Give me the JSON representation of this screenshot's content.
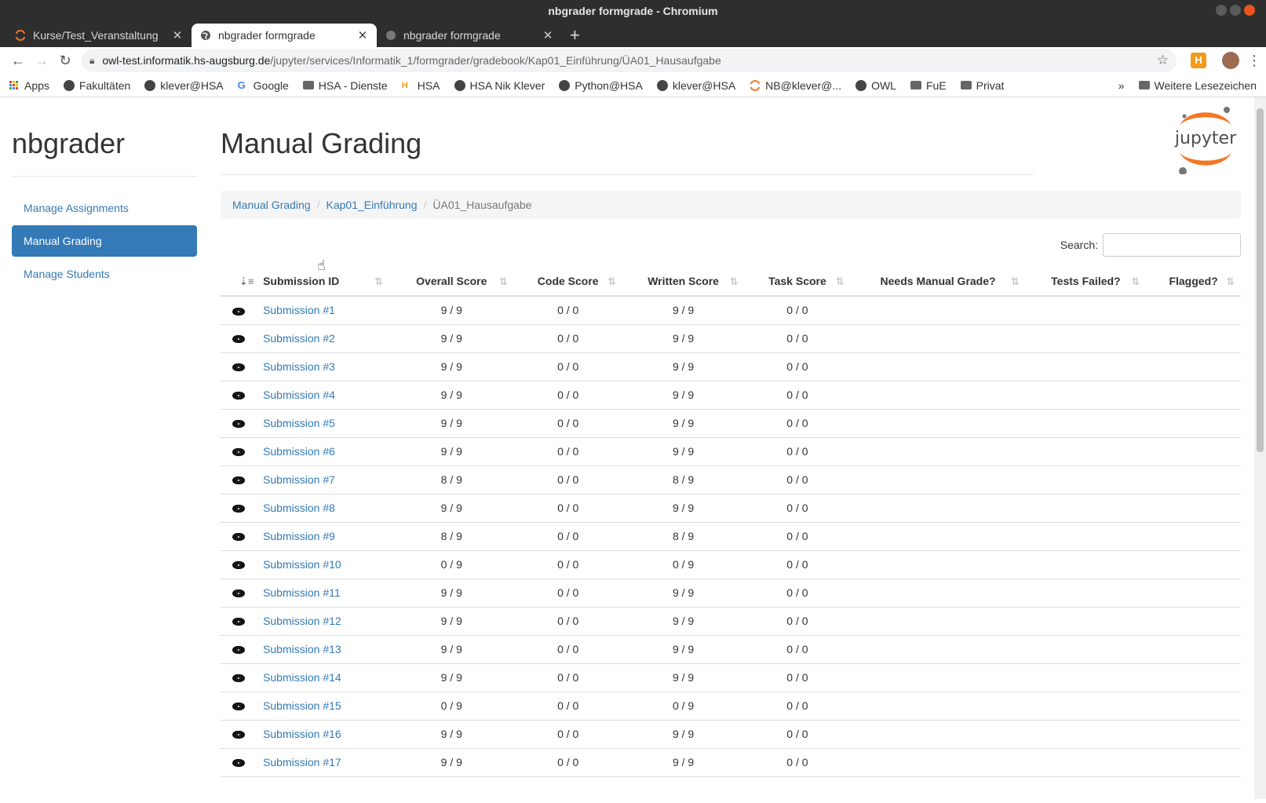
{
  "window": {
    "title": "nbgrader formgrade - Chromium"
  },
  "tabs": [
    {
      "label": "Kurse/Test_Veranstaltung",
      "active": false,
      "icon": "jupyter-icon"
    },
    {
      "label": "nbgrader formgrade",
      "active": true,
      "icon": "globe-icon"
    },
    {
      "label": "nbgrader formgrade",
      "active": false,
      "icon": "globe-icon"
    }
  ],
  "omnibox": {
    "host": "owl-test.informatik.hs-augsburg.de",
    "path": "/jupyter/services/Informatik_1/formgrader/gradebook/Kap01_Einführung/ÜA01_Hausaufgabe"
  },
  "bookmarks": {
    "items": [
      "Apps",
      "Fakultäten",
      "klever@HSA",
      "Google",
      "HSA - Dienste",
      "HSA",
      "HSA Nik Klever",
      "Python@HSA",
      "klever@HSA",
      "NB@klever@...",
      "OWL",
      "FuE",
      "Privat"
    ],
    "more": "»",
    "other": "Weitere Lesezeichen"
  },
  "sidebar": {
    "brand": "nbgrader",
    "items": [
      {
        "label": "Manage Assignments",
        "active": false
      },
      {
        "label": "Manual Grading",
        "active": true
      },
      {
        "label": "Manage Students",
        "active": false
      }
    ]
  },
  "main": {
    "title": "Manual Grading",
    "logo_text": "jupyter",
    "breadcrumb": [
      "Manual Grading",
      "Kap01_Einführung",
      "ÜA01_Hausaufgabe"
    ],
    "search_label": "Search:",
    "search_value": ""
  },
  "table": {
    "columns": [
      "Submission ID",
      "Overall Score",
      "Code Score",
      "Written Score",
      "Task Score",
      "Needs Manual Grade?",
      "Tests Failed?",
      "Flagged?"
    ],
    "rows": [
      {
        "id": "Submission #1",
        "overall": "9 / 9",
        "code": "0 / 0",
        "written": "9 / 9",
        "task": "0 / 0"
      },
      {
        "id": "Submission #2",
        "overall": "9 / 9",
        "code": "0 / 0",
        "written": "9 / 9",
        "task": "0 / 0"
      },
      {
        "id": "Submission #3",
        "overall": "9 / 9",
        "code": "0 / 0",
        "written": "9 / 9",
        "task": "0 / 0"
      },
      {
        "id": "Submission #4",
        "overall": "9 / 9",
        "code": "0 / 0",
        "written": "9 / 9",
        "task": "0 / 0"
      },
      {
        "id": "Submission #5",
        "overall": "9 / 9",
        "code": "0 / 0",
        "written": "9 / 9",
        "task": "0 / 0"
      },
      {
        "id": "Submission #6",
        "overall": "9 / 9",
        "code": "0 / 0",
        "written": "9 / 9",
        "task": "0 / 0"
      },
      {
        "id": "Submission #7",
        "overall": "8 / 9",
        "code": "0 / 0",
        "written": "8 / 9",
        "task": "0 / 0"
      },
      {
        "id": "Submission #8",
        "overall": "9 / 9",
        "code": "0 / 0",
        "written": "9 / 9",
        "task": "0 / 0"
      },
      {
        "id": "Submission #9",
        "overall": "8 / 9",
        "code": "0 / 0",
        "written": "8 / 9",
        "task": "0 / 0"
      },
      {
        "id": "Submission #10",
        "overall": "0 / 9",
        "code": "0 / 0",
        "written": "0 / 9",
        "task": "0 / 0"
      },
      {
        "id": "Submission #11",
        "overall": "9 / 9",
        "code": "0 / 0",
        "written": "9 / 9",
        "task": "0 / 0"
      },
      {
        "id": "Submission #12",
        "overall": "9 / 9",
        "code": "0 / 0",
        "written": "9 / 9",
        "task": "0 / 0"
      },
      {
        "id": "Submission #13",
        "overall": "9 / 9",
        "code": "0 / 0",
        "written": "9 / 9",
        "task": "0 / 0"
      },
      {
        "id": "Submission #14",
        "overall": "9 / 9",
        "code": "0 / 0",
        "written": "9 / 9",
        "task": "0 / 0"
      },
      {
        "id": "Submission #15",
        "overall": "0 / 9",
        "code": "0 / 0",
        "written": "0 / 9",
        "task": "0 / 0"
      },
      {
        "id": "Submission #16",
        "overall": "9 / 9",
        "code": "0 / 0",
        "written": "9 / 9",
        "task": "0 / 0"
      },
      {
        "id": "Submission #17",
        "overall": "9 / 9",
        "code": "0 / 0",
        "written": "9 / 9",
        "task": "0 / 0"
      }
    ]
  },
  "colors": {
    "link": "#337ab7",
    "active_nav": "#337ab7",
    "jupyter_orange": "#f37726"
  }
}
